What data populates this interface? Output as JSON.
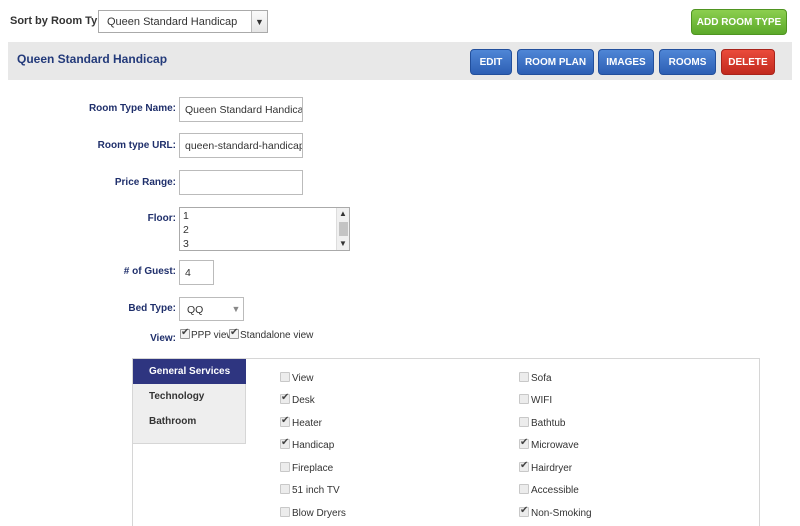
{
  "sort": {
    "label": "Sort by Room Type:",
    "selected": "Queen Standard Handicap"
  },
  "toolbar": {
    "add_room_type": "ADD ROOM TYPE"
  },
  "header": {
    "title": "Queen Standard Handicap",
    "buttons": {
      "edit": "EDIT",
      "room_plan": "ROOM PLAN",
      "images": "IMAGES",
      "rooms": "ROOMS",
      "delete": "DELETE"
    }
  },
  "form": {
    "room_type_name": {
      "label": "Room Type Name:",
      "value": "Queen Standard Handicap"
    },
    "room_type_url": {
      "label": "Room type URL:",
      "value": "queen-standard-handicap"
    },
    "price_range": {
      "label": "Price Range:",
      "value": ""
    },
    "floor": {
      "label": "Floor:",
      "options": [
        "1",
        "2",
        "3"
      ]
    },
    "guests": {
      "label": "# of Guest:",
      "value": "4"
    },
    "bed_type": {
      "label": "Bed Type:",
      "selected": "QQ"
    },
    "view": {
      "label": "View:",
      "ppp_view": "PPP view",
      "standalone_view": "Standalone view"
    }
  },
  "tabs": [
    "General Services",
    "Technology",
    "Bathroom"
  ],
  "services": {
    "left": [
      {
        "label": "View",
        "checked": false
      },
      {
        "label": "Desk",
        "checked": true
      },
      {
        "label": "Heater",
        "checked": true
      },
      {
        "label": "Handicap",
        "checked": true
      },
      {
        "label": "Fireplace",
        "checked": false
      },
      {
        "label": "51 inch TV",
        "checked": false
      },
      {
        "label": "Blow Dryers",
        "checked": false
      }
    ],
    "right": [
      {
        "label": "Sofa",
        "checked": false
      },
      {
        "label": "WIFI",
        "checked": false
      },
      {
        "label": "Bathtub",
        "checked": false
      },
      {
        "label": "Microwave",
        "checked": true
      },
      {
        "label": "Hairdryer",
        "checked": true
      },
      {
        "label": "Accessible",
        "checked": false
      },
      {
        "label": "Non-Smoking",
        "checked": true
      }
    ]
  },
  "colors": {
    "accent_blue": "#2d5fb4",
    "green": "#5ca92a",
    "red": "#c22a1e",
    "active_tab": "#2e3580",
    "label_navy": "#1f2f6b"
  }
}
